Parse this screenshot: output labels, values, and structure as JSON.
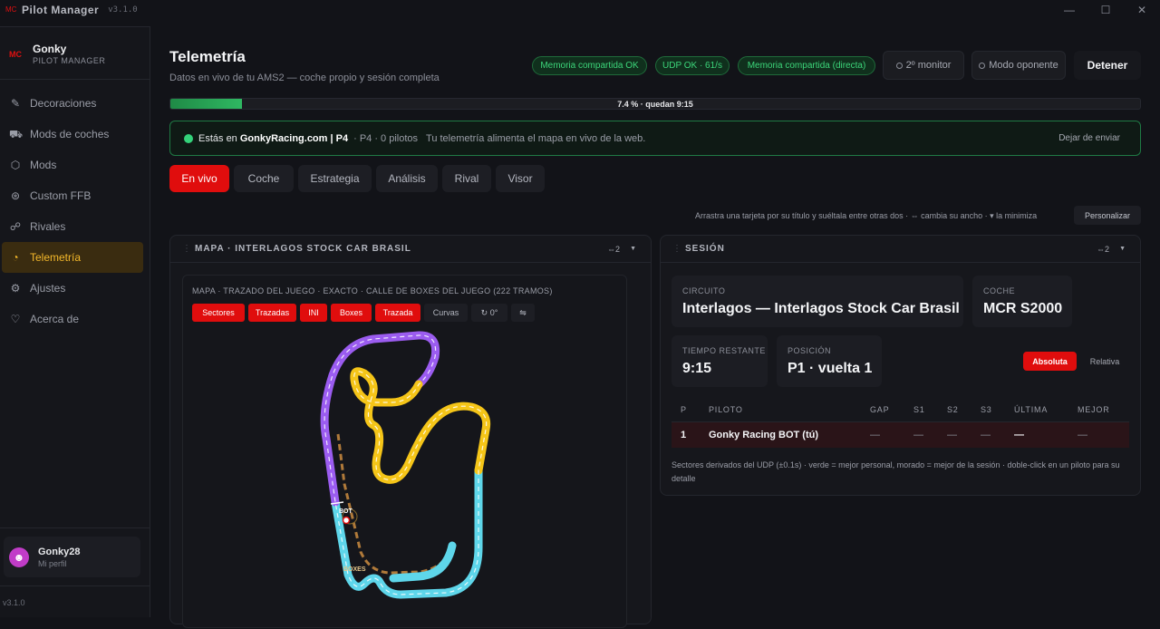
{
  "titlebar": {
    "app_name": "Pilot Manager",
    "version": "v3.1.0",
    "logo": "MC",
    "minimize": "—",
    "maximize": "☐",
    "close": "✕"
  },
  "sidebar": {
    "brand_name": "Gonky",
    "brand_sub": "PILOT MANAGER",
    "logo": "MC",
    "items": [
      {
        "label": "Decoraciones",
        "icon": "brush-icon",
        "glyph": "✎"
      },
      {
        "label": "Mods de coches",
        "icon": "car-icon",
        "glyph": "⛟"
      },
      {
        "label": "Mods",
        "icon": "package-icon",
        "glyph": "⬡"
      },
      {
        "label": "Custom FFB",
        "icon": "steering-icon",
        "glyph": "⊛"
      },
      {
        "label": "Rivales",
        "icon": "users-icon",
        "glyph": "☍"
      },
      {
        "label": "Telemetría",
        "icon": "gauge-icon",
        "glyph": "◔"
      },
      {
        "label": "Ajustes",
        "icon": "gear-icon",
        "glyph": "⚙"
      },
      {
        "label": "Acerca de",
        "icon": "heart-icon",
        "glyph": "♡"
      }
    ],
    "profile_name": "Gonky28",
    "profile_sub": "Mi perfil",
    "version": "v3.1.0"
  },
  "header": {
    "title": "Telemetría",
    "subtitle": "Datos en vivo de tu AMS2 — coche propio y sesión completa",
    "pills": [
      "Memoria compartida OK",
      "UDP OK · 61/s",
      "Memoria compartida (directa)"
    ],
    "second_monitor": "2º monitor",
    "opponent_mode": "Modo oponente",
    "stop": "Detener"
  },
  "progress": {
    "value": 7.4,
    "label": "7.4 % · quedan 9:15"
  },
  "banner": {
    "prefix": "Estás en ",
    "site": "GonkyRacing.com | P4",
    "info": "· P4 · 0 pilotos",
    "desc": "Tu telemetría alimenta el mapa en vivo de la web.",
    "stop_send": "Dejar de enviar"
  },
  "tabs": [
    "En vivo",
    "Coche",
    "Estrategia",
    "Análisis",
    "Rival",
    "Visor"
  ],
  "hint": "Arrastra una tarjeta por su título y suéltala entre otras dos · ⇔ cambia su ancho · ▾ la minimiza",
  "customize": "Personalizar",
  "map_card": {
    "title": "MAPA · INTERLAGOS STOCK CAR BRASIL",
    "width_btn": "⇔2",
    "min_btn": "▼",
    "subtitle": "MAPA · TRAZADO DEL JUEGO · EXACTO · CALLE DE BOXES DEL JUEGO (222 TRAMOS)",
    "toolbar": [
      {
        "label": "Sectores",
        "on": true
      },
      {
        "label": "Trazadas",
        "on": true
      },
      {
        "label": "INI",
        "on": true
      },
      {
        "label": "Boxes",
        "on": true
      },
      {
        "label": "Trazada",
        "on": true
      },
      {
        "label": "Curvas",
        "on": false
      },
      {
        "label": "↻ 0°",
        "on": false
      },
      {
        "label": "⇋",
        "on": false
      }
    ],
    "car_label": "BOT",
    "pit_label": "BOXES",
    "sector_colors": [
      "#9b5cf0",
      "#f5c518",
      "#5ed6ea"
    ],
    "pit_color": "#b07a3a"
  },
  "session_card": {
    "title": "SESIÓN",
    "width_btn": "⇔2",
    "min_btn": "▼",
    "circuit_label": "CIRCUITO",
    "circuit_value": "Interlagos — Interlagos Stock Car Brasil",
    "car_label": "COCHE",
    "car_value": "MCR S2000",
    "time_label": "TIEMPO RESTANTE",
    "time_value": "9:15",
    "pos_label": "POSICIÓN",
    "pos_value": "P1 · vuelta 1",
    "seg_absolute": "Absoluta",
    "seg_relative": "Relativa",
    "columns": [
      "P",
      "PILOTO",
      "GAP",
      "S1",
      "S2",
      "S3",
      "ÚLTIMA",
      "MEJOR"
    ],
    "rows": [
      {
        "p": "1",
        "driver": "Gonky Racing BOT (tú)",
        "gap": "—",
        "s1": "—",
        "s2": "—",
        "s3": "—",
        "last": "—",
        "best": "—"
      }
    ],
    "note": "Sectores derivados del UDP (±0.1s) · verde = mejor personal, morado = mejor de la sesión · doble-click en un piloto para su detalle"
  }
}
